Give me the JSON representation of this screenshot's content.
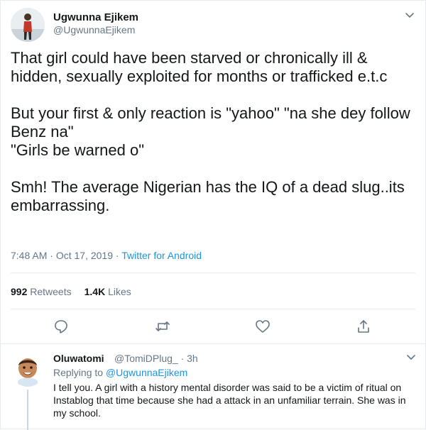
{
  "tweet": {
    "author_name": "Ugwunna Ejikem",
    "author_handle": "@UgwunnaEjikem",
    "paragraphs": [
      "That girl could have been starved or chronically ill & hidden, sexually exploited for months or trafficked e.t.c",
      "But your first & only reaction is \"yahoo\" \"na she dey follow Benz na\"\n\"Girls be warned o\"",
      "Smh! The average Nigerian has the IQ of a dead slug..its embarrassing."
    ],
    "time": "7:48 AM",
    "date": "Oct 17, 2019",
    "separator": "·",
    "source": "Twitter for Android",
    "retweet_count": "992",
    "retweet_label": "Retweets",
    "like_count": "1.4K",
    "like_label": "Likes"
  },
  "actions": {
    "reply_icon": "reply-icon",
    "retweet_icon": "retweet-icon",
    "like_icon": "heart-icon",
    "share_icon": "share-icon"
  },
  "reply": {
    "author_name": "Oluwatomi",
    "author_handle": "@TomiDPlug_ · 3h",
    "replying_prefix": "Replying to",
    "replying_to": "@UgwunnaEjikem",
    "text": "I tell you. A girl with a history  mental disorder was said to be a victim of ritual on Instablog that time because she had a attack in an unfamiliar terrain. She was in my school."
  },
  "colors": {
    "link": "#1b95e0",
    "muted": "#657786",
    "text": "#14171a",
    "border": "#e6ecf0"
  }
}
